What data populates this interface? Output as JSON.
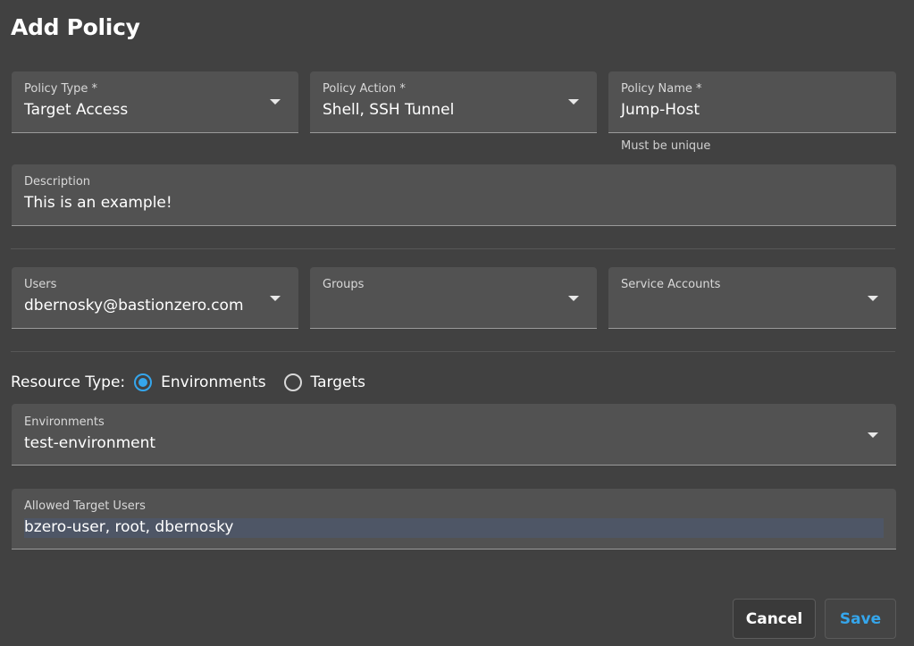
{
  "page": {
    "title": "Add Policy"
  },
  "fields": {
    "policy_type": {
      "label": "Policy Type *",
      "value": "Target Access"
    },
    "policy_action": {
      "label": "Policy Action *",
      "value": "Shell, SSH Tunnel"
    },
    "policy_name": {
      "label": "Policy Name *",
      "value": "Jump-Host",
      "hint": "Must be unique"
    },
    "description": {
      "label": "Description",
      "value": "This is an example!"
    },
    "users": {
      "label": "Users",
      "value": "dbernosky@bastionzero.com"
    },
    "groups": {
      "label": "Groups",
      "value": ""
    },
    "service_accounts": {
      "label": "Service Accounts",
      "value": ""
    },
    "environments": {
      "label": "Environments",
      "value": "test-environment"
    },
    "allowed_target_users": {
      "label": "Allowed Target Users",
      "value": "bzero-user, root, dbernosky"
    }
  },
  "resource_type": {
    "label": "Resource Type:",
    "options": [
      {
        "label": "Environments",
        "selected": true
      },
      {
        "label": "Targets",
        "selected": false
      }
    ]
  },
  "actions": {
    "cancel_label": "Cancel",
    "save_label": "Save"
  },
  "colors": {
    "background": "#414141",
    "field": "#525252",
    "accent": "#35a6ec"
  }
}
